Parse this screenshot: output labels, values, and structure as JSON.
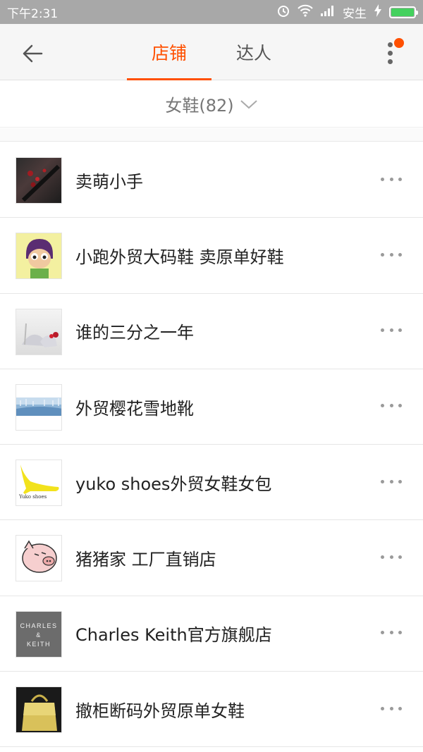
{
  "status_bar": {
    "time": "下午2:31",
    "carrier": "安生"
  },
  "nav": {
    "tabs": [
      {
        "label": "店铺",
        "active": true
      },
      {
        "label": "达人",
        "active": false
      }
    ]
  },
  "filter": {
    "label": "女鞋(82)"
  },
  "colors": {
    "accent": "#ff5000",
    "battery": "#44d15e"
  },
  "shops": [
    {
      "name": "卖萌小手",
      "thumb_icon": "roses-photo"
    },
    {
      "name": "小跑外贸大码鞋 卖原单好鞋",
      "thumb_icon": "cartoon-avatar"
    },
    {
      "name": "谁的三分之一年",
      "thumb_icon": "crystal-heels-photo"
    },
    {
      "name": "外贸樱花雪地靴",
      "thumb_icon": "snow-landscape"
    },
    {
      "name": "yuko shoes外贸女鞋女包",
      "thumb_icon": "yellow-heel",
      "thumb_text": "Yuko shoes"
    },
    {
      "name": "猪猪家 工厂直销店",
      "thumb_icon": "pig-cartoon"
    },
    {
      "name": "Charles Keith官方旗舰店",
      "thumb_icon": "charles-keith-logo",
      "thumb_text": "CHARLES & KEITH"
    },
    {
      "name": "撤柜断码外贸原单女鞋",
      "thumb_icon": "gold-bag-photo"
    }
  ]
}
